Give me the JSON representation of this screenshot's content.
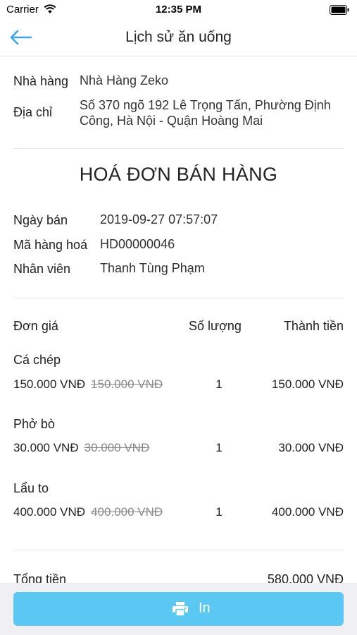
{
  "status": {
    "carrier": "Carrier",
    "time": "12:35 PM"
  },
  "nav": {
    "title": "Lịch sử ăn uống"
  },
  "restaurant": {
    "name_label": "Nhà hàng",
    "name": "Nhà Hàng Zeko",
    "address_label": "Địa chỉ",
    "address_line1": "Số 370 ngõ 192 Lê Trọng Tấn, Phường Định",
    "address_line2": "Công, Hà Nội - Quận Hoàng Mai"
  },
  "invoice": {
    "title": "HOÁ ĐƠN BÁN HÀNG",
    "date_label": "Ngày bán",
    "date": "2019-09-27 07:57:07",
    "code_label": "Mã hàng hoá",
    "code": "HD00000046",
    "staff_label": "Nhân viên",
    "staff": "Thanh Tùng Phạm"
  },
  "table": {
    "headers": {
      "price": "Đơn giá",
      "quantity": "Số lượng",
      "total": "Thành tiền"
    },
    "items": [
      {
        "name": "Cá chép",
        "price": "150.000 VNĐ",
        "old_price": "150.000 VNĐ",
        "quantity": "1",
        "total": "150.000 VNĐ"
      },
      {
        "name": "Phở bò",
        "price": "30.000 VNĐ",
        "old_price": "30.000 VNĐ",
        "quantity": "1",
        "total": "30.000 VNĐ"
      },
      {
        "name": "Lẩu to",
        "price": "400.000 VNĐ",
        "old_price": "400.000 VNĐ",
        "quantity": "1",
        "total": "400.000 VNĐ"
      }
    ]
  },
  "summary": {
    "total_label": "Tổng tiền",
    "total_value": "580.000 VNĐ"
  },
  "footer": {
    "print_label": "In"
  },
  "colors": {
    "accent": "#5ac8f2",
    "back_arrow": "#3aa7e8"
  }
}
